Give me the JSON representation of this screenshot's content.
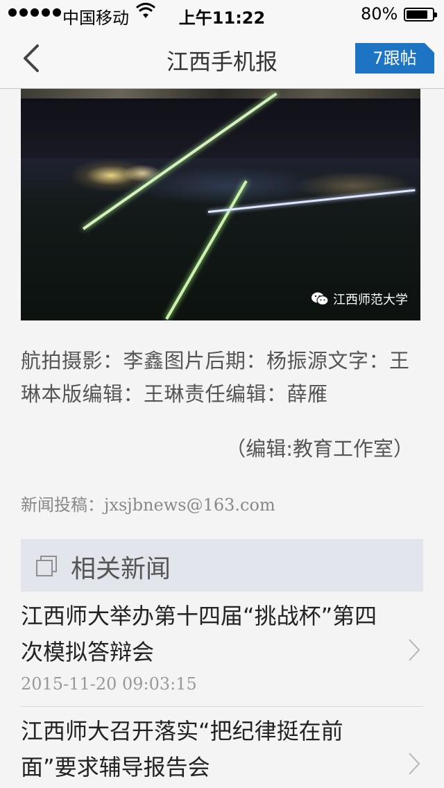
{
  "status_bar": {
    "carrier": "中国移动",
    "time": "上午11:22",
    "battery": "80%"
  },
  "nav": {
    "title": "江西手机报",
    "follow_label": "7跟帖"
  },
  "photo": {
    "watermark": "江西师范大学"
  },
  "article": {
    "credits": "航拍摄影：李鑫图片后期：杨振源文字：王琳本版编辑：王琳责任编辑：薛雁",
    "editor": "（编辑:教育工作室）",
    "submission": "新闻投稿：jxsjbnews@163.com"
  },
  "related": {
    "title": "相关新闻",
    "items": [
      {
        "headline": "江西师大举办第十四届“挑战杯”第四次模拟答辩会",
        "date": "2015-11-20 09:03:15"
      },
      {
        "headline": "江西师大召开落实“把纪律挺在前面”要求辅导报告会",
        "date": ""
      }
    ]
  },
  "colors": {
    "accent": "#1c74c3",
    "background": "#f4f4f4",
    "related_header_bg": "#e3e5ec"
  }
}
